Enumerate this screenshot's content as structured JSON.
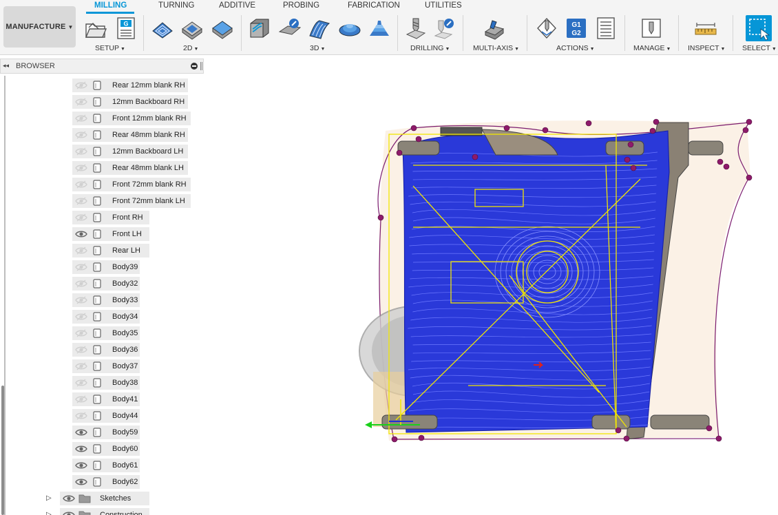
{
  "workspace": {
    "label": "MANUFACTURE"
  },
  "tabs": [
    {
      "label": "MILLING",
      "active": true
    },
    {
      "label": "TURNING",
      "active": false
    },
    {
      "label": "ADDITIVE",
      "active": false
    },
    {
      "label": "PROBING",
      "active": false
    },
    {
      "label": "FABRICATION",
      "active": false
    },
    {
      "label": "UTILITIES",
      "active": false
    }
  ],
  "groups": {
    "setup": "SETUP",
    "two_d": "2D",
    "three_d": "3D",
    "drilling": "DRILLING",
    "multi_axis": "MULTI-AXIS",
    "actions": "ACTIONS",
    "manage": "MANAGE",
    "inspect": "INSPECT",
    "select": "SELECT"
  },
  "tool_icons": {
    "setup_text": "G",
    "actions_g1": "G1",
    "actions_g2": "G2"
  },
  "browser": {
    "title": "BROWSER",
    "bodies": [
      {
        "label": "Rear 12mm blank RH",
        "visible": false
      },
      {
        "label": "12mm Backboard RH",
        "visible": false
      },
      {
        "label": "Front 12mm blank RH",
        "visible": false
      },
      {
        "label": "Rear 48mm blank RH",
        "visible": false
      },
      {
        "label": "12mm Backboard LH",
        "visible": false
      },
      {
        "label": "Rear 48mm blank LH",
        "visible": false
      },
      {
        "label": "Front  72mm blank RH",
        "visible": false
      },
      {
        "label": "Front  72mm blank LH",
        "visible": false
      },
      {
        "label": "Front RH",
        "visible": false
      },
      {
        "label": "Front LH",
        "visible": true
      },
      {
        "label": "Rear LH",
        "visible": false
      },
      {
        "label": "Body39",
        "visible": false
      },
      {
        "label": "Body32",
        "visible": false
      },
      {
        "label": "Body33",
        "visible": false
      },
      {
        "label": "Body34",
        "visible": false
      },
      {
        "label": "Body35",
        "visible": false
      },
      {
        "label": "Body36",
        "visible": false
      },
      {
        "label": "Body37",
        "visible": false
      },
      {
        "label": "Body38",
        "visible": false
      },
      {
        "label": "Body41",
        "visible": false
      },
      {
        "label": "Body44",
        "visible": false
      },
      {
        "label": "Body59",
        "visible": true
      },
      {
        "label": "Body60",
        "visible": true
      },
      {
        "label": "Body61",
        "visible": true
      },
      {
        "label": "Body62",
        "visible": true
      }
    ],
    "folders": [
      {
        "label": "Sketches"
      },
      {
        "label": "Construction"
      }
    ]
  },
  "colors": {
    "accent": "#0696d7",
    "toolpath": "#1f2fd6",
    "sketch": "#f2e600",
    "boundary": "#7a1a6e"
  }
}
